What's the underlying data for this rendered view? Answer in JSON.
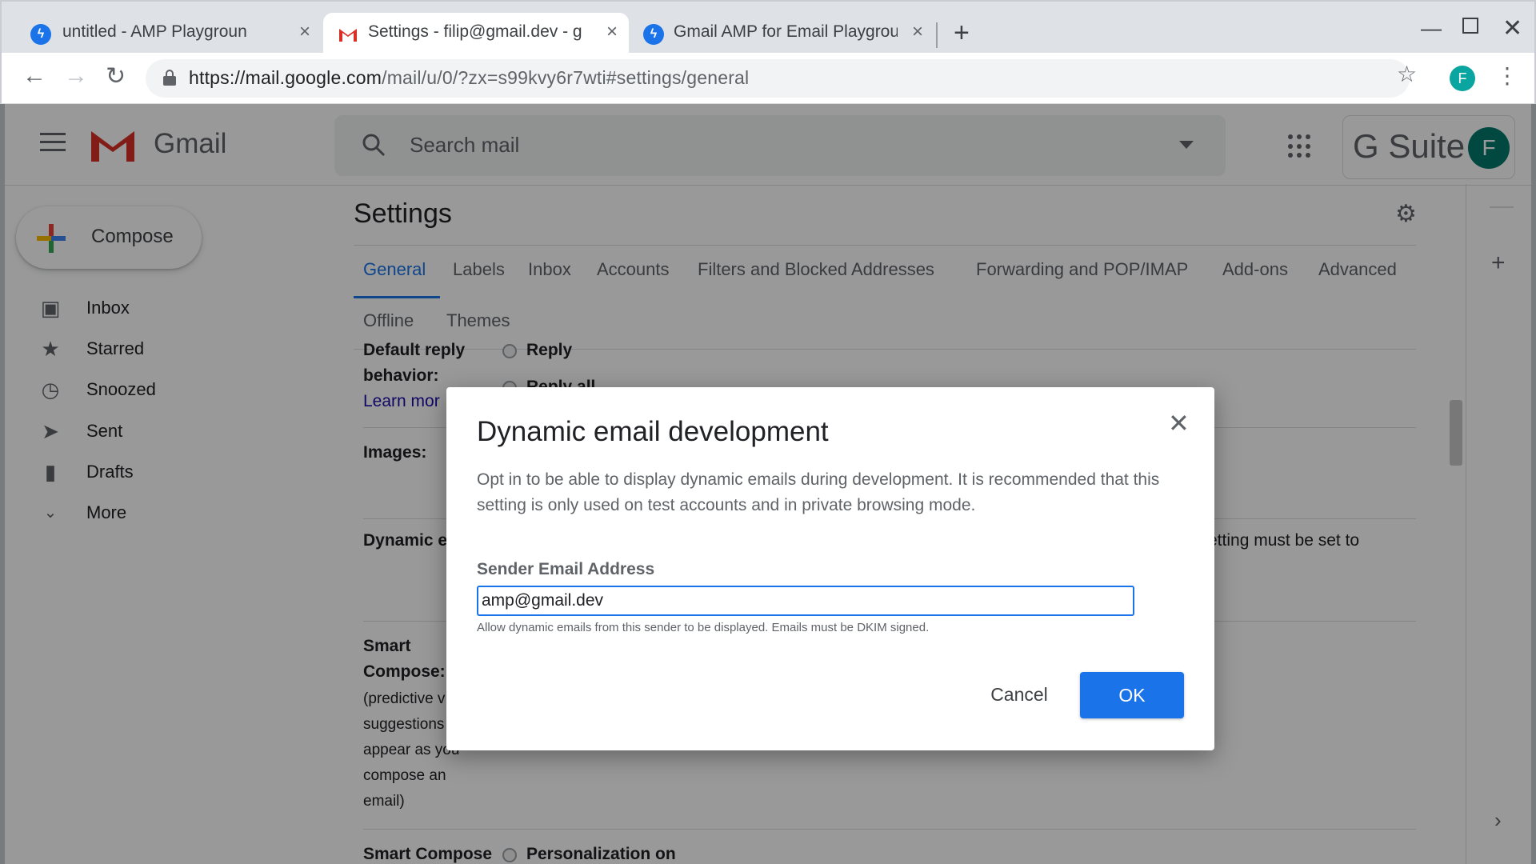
{
  "browser": {
    "tabs": [
      {
        "title": "untitled - AMP Playground",
        "active": false
      },
      {
        "title": "Settings - filip@gmail.dev - g",
        "active": true
      },
      {
        "title": "Gmail AMP for Email Playgrou",
        "active": false
      }
    ],
    "url_host": "https://mail.google.com",
    "url_path": "/mail/u/0/?zx=s99kvy6r7wti#settings/general",
    "profile_initial": "F"
  },
  "gmail": {
    "wordmark": "Gmail",
    "search_placeholder": "Search mail",
    "gsuite_label": "G Suite",
    "account_initial": "F",
    "compose_label": "Compose",
    "nav": [
      {
        "label": "Inbox",
        "icon": "inbox-icon"
      },
      {
        "label": "Starred",
        "icon": "star-icon"
      },
      {
        "label": "Snoozed",
        "icon": "clock-icon"
      },
      {
        "label": "Sent",
        "icon": "send-icon"
      },
      {
        "label": "Drafts",
        "icon": "draft-icon"
      },
      {
        "label": "More",
        "icon": "chevron-down-icon"
      }
    ]
  },
  "settings": {
    "title": "Settings",
    "tabs": [
      "General",
      "Labels",
      "Inbox",
      "Accounts",
      "Filters and Blocked Addresses",
      "Forwarding and POP/IMAP",
      "Add-ons",
      "Advanced",
      "Offline",
      "Themes"
    ],
    "active_tab": "General",
    "reply_label_1": "Default reply",
    "reply_label_2": "behavior:",
    "learn_more": "Learn mor",
    "reply_option": "Reply",
    "reply_all_option": "Reply all",
    "images_label": "Images:",
    "dynamic_label": "Dynamic e",
    "dynamic_tail": "etting must be set to",
    "smart_compose_1": "Smart",
    "smart_compose_2": "Compose:",
    "smart_compose_desc": [
      "(predictive v",
      "suggestions",
      "appear as you",
      "compose an",
      "email)"
    ],
    "smart_compose_personal": "Smart Compose",
    "personalization_on": "Personalization on"
  },
  "dialog": {
    "title": "Dynamic email development",
    "body": "Opt in to be able to display dynamic emails during development. It is recommended that this setting is only used on test accounts and in private browsing mode.",
    "field_label": "Sender Email Address",
    "field_value": "amp@gmail.dev",
    "help_text": "Allow dynamic emails from this sender to be displayed. Emails must be DKIM signed.",
    "cancel_label": "Cancel",
    "ok_label": "OK"
  },
  "colors": {
    "accent": "#1a73e8",
    "scrim": "rgba(0,0,0,0.40)"
  }
}
